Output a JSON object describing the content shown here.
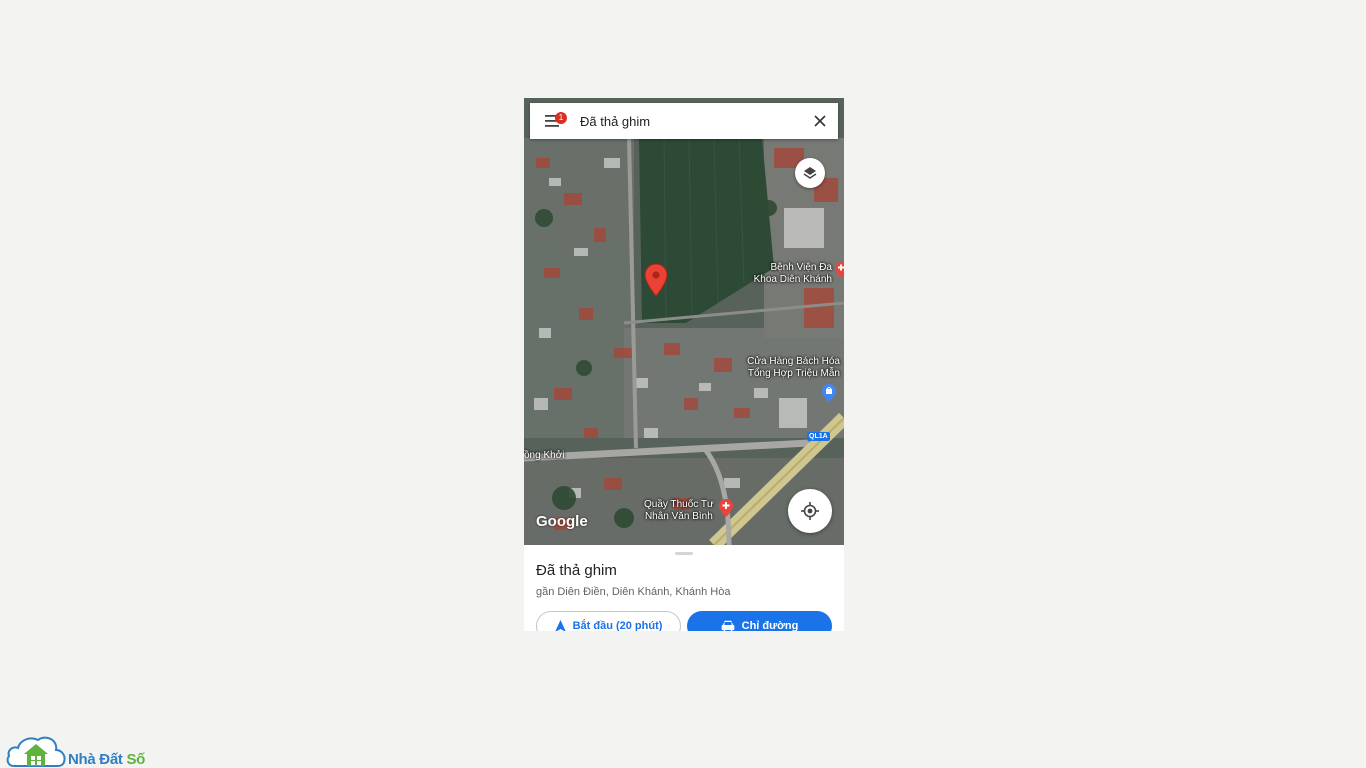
{
  "search": {
    "value": "Đã thả ghim",
    "menu_badge": "1"
  },
  "map": {
    "poi_hospital": {
      "line1": "Bệnh Viện Đa",
      "line2": "Khoa Diên Khánh"
    },
    "poi_store": {
      "line1": "Cửa Hàng Bách Hóa",
      "line2": "Tổng Hợp Triệu Mẫn"
    },
    "poi_pharmacy": {
      "line1": "Quầy Thuốc Tư",
      "line2": "Nhân Văn Bình"
    },
    "street_label": "ồng Khởi",
    "road_shield": "QL1A",
    "logo": "Google",
    "colors": {
      "pin": "#ea4335",
      "accent": "#1a73e8"
    }
  },
  "sheet": {
    "title": "Đã thả ghim",
    "address": "gần Diên Điền, Diên Khánh, Khánh Hòa",
    "start_label": "Bắt đầu (20 phút)",
    "directions_label": "Chỉ đường"
  },
  "watermark": {
    "brand_part1": "Nhà Đất ",
    "brand_part2": "Số"
  },
  "icons": [
    "menu-icon",
    "close-icon",
    "layers-icon",
    "location-pin-icon",
    "hospital-icon",
    "shopping-bag-icon",
    "pharmacy-icon",
    "my-location-icon",
    "navigation-arrow-icon",
    "car-icon",
    "house-cloud-logo"
  ]
}
